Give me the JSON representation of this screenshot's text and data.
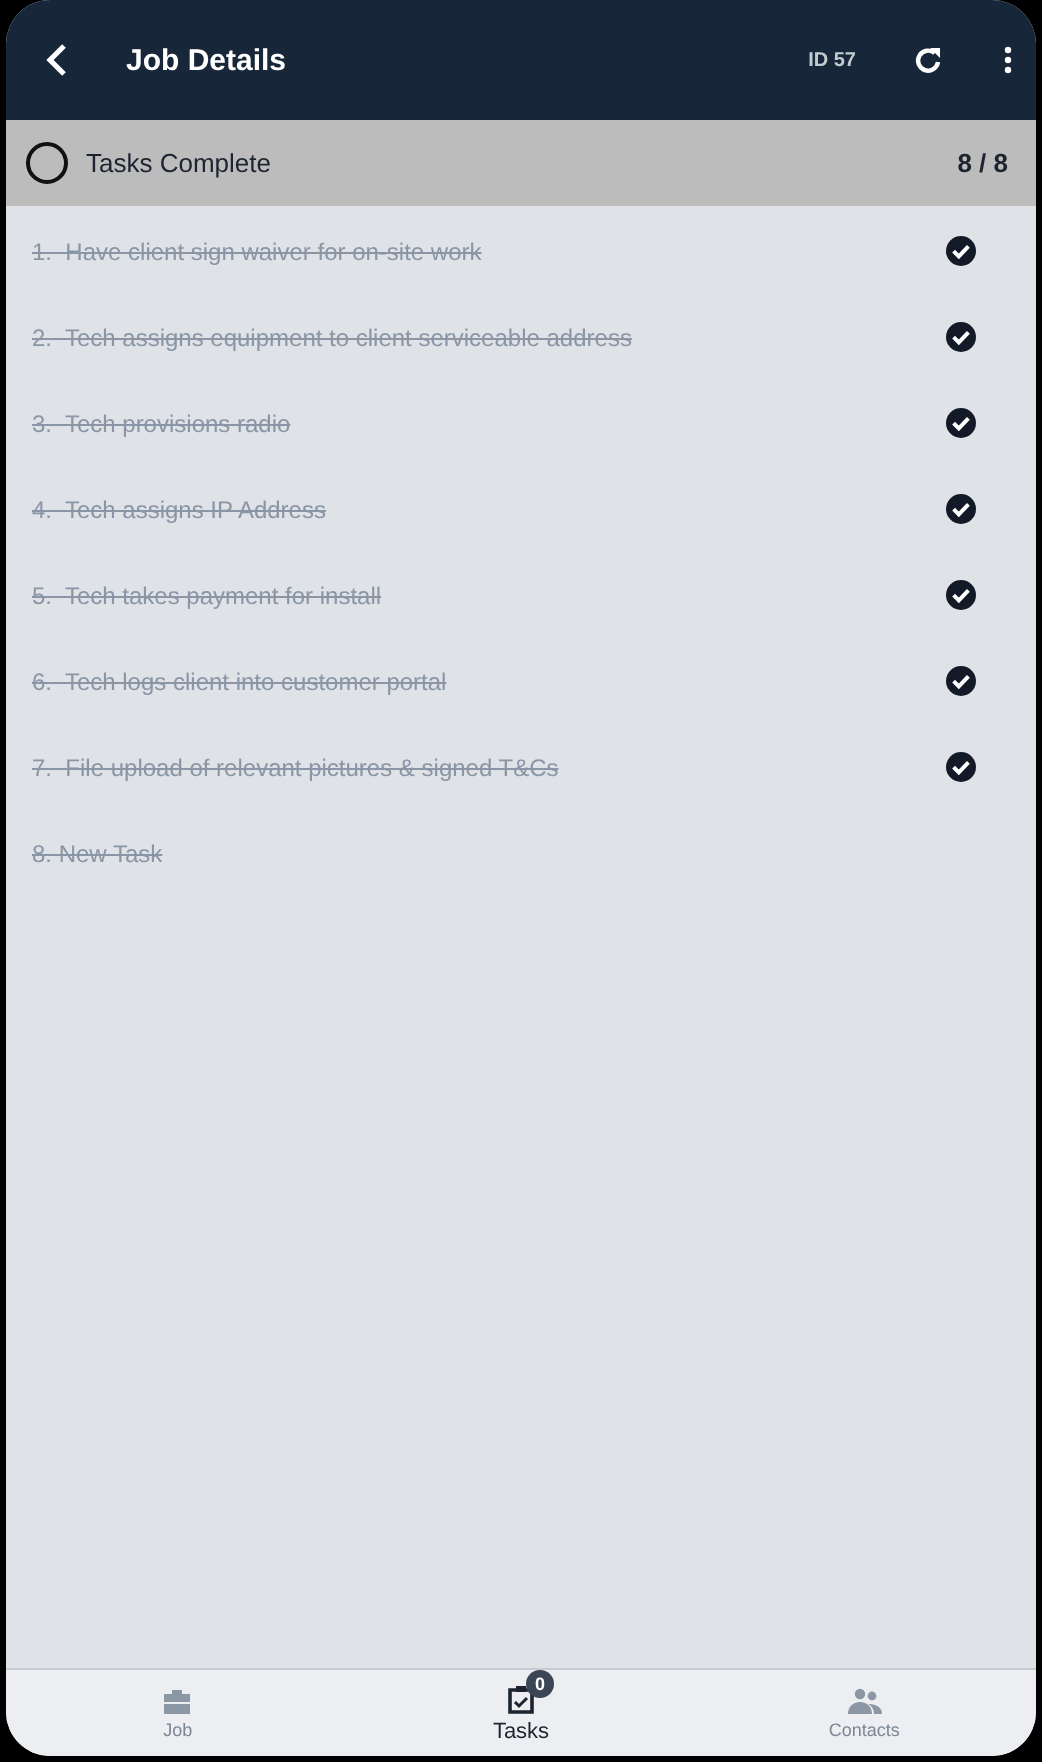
{
  "header": {
    "title": "Job Details",
    "id_label": "ID 57"
  },
  "summary": {
    "label": "Tasks Complete",
    "count": "8 / 8"
  },
  "tasks": [
    {
      "text": "1.  Have client sign waiver for on-site work",
      "done": true,
      "checked": true
    },
    {
      "text": "2.  Tech assigns equipment to client serviceable address",
      "done": true,
      "checked": true
    },
    {
      "text": "3.  Tech provisions radio",
      "done": true,
      "checked": true
    },
    {
      "text": "4.  Tech assigns IP Address",
      "done": true,
      "checked": true
    },
    {
      "text": "5.  Tech takes payment for install",
      "done": true,
      "checked": true
    },
    {
      "text": "6.  Tech logs client into customer portal",
      "done": true,
      "checked": true
    },
    {
      "text": "7.  File upload of relevant pictures & signed T&Cs",
      "done": true,
      "checked": true
    },
    {
      "text": "8. New Task",
      "done": true,
      "checked": false
    }
  ],
  "tabs": [
    {
      "label": "Job",
      "kind": "job",
      "selected": false
    },
    {
      "label": "Tasks",
      "kind": "tasks",
      "selected": true,
      "badge": "0"
    },
    {
      "label": "Contacts",
      "kind": "contacts",
      "selected": false
    }
  ]
}
